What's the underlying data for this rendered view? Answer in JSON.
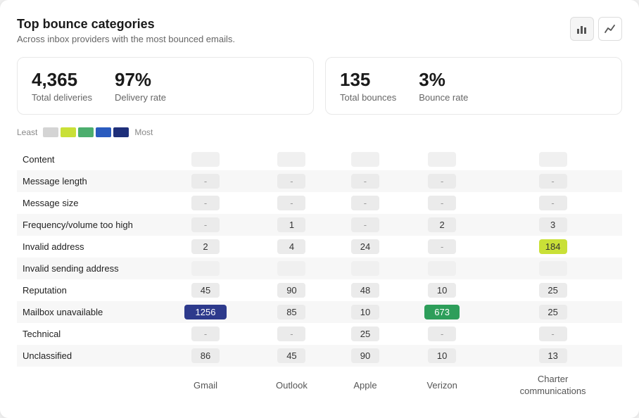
{
  "title": "Top bounce categories",
  "subtitle": "Across inbox providers with the most bounced emails.",
  "icons": {
    "bar_chart": "▐",
    "line_chart": "╱"
  },
  "stats_left": {
    "value1": "4,365",
    "label1": "Total deliveries",
    "value2": "97%",
    "label2": "Delivery rate"
  },
  "stats_right": {
    "value1": "135",
    "label1": "Total bounces",
    "value2": "3%",
    "label2": "Bounce rate"
  },
  "legend": {
    "least": "Least",
    "most": "Most",
    "swatches": [
      "#d4d4d4",
      "#c9e037",
      "#4cae6e",
      "#2a5bbf",
      "#1e2f7a"
    ]
  },
  "table": {
    "columns": [
      "Gmail",
      "Outlook",
      "Apple",
      "Verizon",
      "Charter\ncommunications"
    ],
    "rows": [
      {
        "label": "Content",
        "values": [
          "",
          "",
          "",
          "",
          ""
        ]
      },
      {
        "label": "Message length",
        "values": [
          "-",
          "-",
          "-",
          "-",
          "-"
        ]
      },
      {
        "label": "Message size",
        "values": [
          "-",
          "-",
          "-",
          "-",
          "-"
        ]
      },
      {
        "label": "Frequency/volume too high",
        "values": [
          "-",
          "1",
          "-",
          "2",
          "3"
        ]
      },
      {
        "label": "Invalid address",
        "values": [
          "2",
          "4",
          "24",
          "-",
          "184"
        ]
      },
      {
        "label": "Invalid sending address",
        "values": [
          "",
          "",
          "",
          "",
          ""
        ]
      },
      {
        "label": "Reputation",
        "values": [
          "45",
          "90",
          "48",
          "10",
          "25"
        ]
      },
      {
        "label": "Mailbox unavailable",
        "values": [
          "1256",
          "85",
          "10",
          "673",
          "25"
        ]
      },
      {
        "label": "Technical",
        "values": [
          "-",
          "-",
          "25",
          "-",
          "-"
        ]
      },
      {
        "label": "Unclassified",
        "values": [
          "86",
          "45",
          "90",
          "10",
          "13"
        ]
      }
    ]
  }
}
